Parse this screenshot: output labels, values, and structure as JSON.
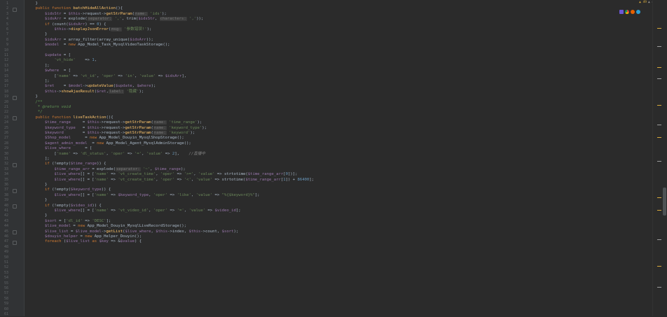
{
  "gutter": {
    "line_numbers": [
      "1",
      "2",
      "3",
      "4",
      "5",
      "6",
      "7",
      "8",
      "9",
      "10",
      "11",
      "12",
      "13",
      "14",
      "15",
      "16",
      "17",
      "18",
      "19",
      "20",
      "21",
      "22",
      "23",
      "24",
      "25",
      "26",
      "27",
      "28",
      "29",
      "30",
      "31",
      "32",
      "33",
      "34",
      "35",
      "36",
      "37",
      "38",
      "39",
      "40",
      "41",
      "42",
      "43",
      "44",
      "45",
      "46",
      "47",
      "48",
      "49",
      "50",
      "51",
      "52",
      "53",
      "54",
      "55",
      "56",
      "57",
      "58",
      "59",
      "60",
      "61"
    ]
  },
  "inspection": {
    "warnings": "▲ 49",
    "weak": "▲ 46",
    "ok": "✓ 1"
  },
  "browser_icons": [
    "phpstorm-icon",
    "chrome-icon",
    "firefox-icon",
    "edge-icon"
  ],
  "code_lines": [
    [
      [
        "    }",
        "d"
      ]
    ],
    [
      [
        "    ",
        "d"
      ],
      [
        "public function ",
        "kw"
      ],
      [
        "batchHideAllAction",
        "fn"
      ],
      [
        "(){",
        "d"
      ]
    ],
    [
      [
        "        ",
        "d"
      ],
      [
        "$idsStr",
        "var"
      ],
      [
        " = ",
        "d"
      ],
      [
        "$this",
        "var"
      ],
      [
        "->request->",
        "d"
      ],
      [
        "getStrParam",
        "fn"
      ],
      [
        "(",
        "d"
      ],
      [
        "name:",
        "hint"
      ],
      [
        " ",
        "d"
      ],
      [
        "'ids'",
        "str"
      ],
      [
        ");",
        "d"
      ]
    ],
    [
      [
        "        ",
        "d"
      ],
      [
        "$idsArr",
        "var"
      ],
      [
        " = explode(",
        "d"
      ],
      [
        "separator:",
        "hint"
      ],
      [
        " ",
        "d"
      ],
      [
        "','",
        "str"
      ],
      [
        ", trim(",
        "d"
      ],
      [
        "$idsStr",
        "var"
      ],
      [
        ", ",
        "d"
      ],
      [
        "characters:",
        "hint"
      ],
      [
        " ",
        "d"
      ],
      [
        "','",
        "str"
      ],
      [
        "));",
        "d"
      ]
    ],
    [
      [
        "        ",
        "d"
      ],
      [
        "if ",
        "kw"
      ],
      [
        "(count(",
        "d"
      ],
      [
        "$idsArr",
        "var"
      ],
      [
        ") == ",
        "d"
      ],
      [
        "0",
        "num"
      ],
      [
        ") {",
        "d"
      ]
    ],
    [
      [
        "            ",
        "d"
      ],
      [
        "$this",
        "var"
      ],
      [
        "->",
        "d"
      ],
      [
        "displayJsonError",
        "fn"
      ],
      [
        "(",
        "d"
      ],
      [
        "msg:",
        "hint"
      ],
      [
        " ",
        "d"
      ],
      [
        "'参数错误!'",
        "str"
      ],
      [
        ");",
        "d"
      ]
    ],
    [
      [
        "        }",
        "d"
      ]
    ],
    [
      [
        "        ",
        "d"
      ],
      [
        "$idsArr",
        "var"
      ],
      [
        " = array_filter(array_unique(",
        "d"
      ],
      [
        "$idsArr",
        "var"
      ],
      [
        "));",
        "d"
      ]
    ],
    [
      [
        "        ",
        "d"
      ],
      [
        "$model",
        "var"
      ],
      [
        "  = ",
        "d"
      ],
      [
        "new ",
        "kw"
      ],
      [
        "App_Model_Task_MysqlVideoTaskStorage",
        "cls"
      ],
      [
        "();",
        "d"
      ]
    ],
    [
      [
        "",
        "d"
      ]
    ],
    [
      [
        "        ",
        "d"
      ],
      [
        "$update",
        "var"
      ],
      [
        " = [",
        "d"
      ]
    ],
    [
      [
        "            ",
        "d"
      ],
      [
        "'vt_hide'",
        "str"
      ],
      [
        "    => ",
        "d"
      ],
      [
        "1",
        "num"
      ],
      [
        ",",
        "d"
      ]
    ],
    [
      [
        "        ];",
        "d"
      ]
    ],
    [
      [
        "        ",
        "d"
      ],
      [
        "$where",
        "var"
      ],
      [
        "  = [",
        "d"
      ]
    ],
    [
      [
        "            [",
        "d"
      ],
      [
        "'name'",
        "str"
      ],
      [
        " => ",
        "d"
      ],
      [
        "'vt_id'",
        "str"
      ],
      [
        ", ",
        "d"
      ],
      [
        "'oper'",
        "str"
      ],
      [
        " => ",
        "d"
      ],
      [
        "'in'",
        "str"
      ],
      [
        ", ",
        "d"
      ],
      [
        "'value'",
        "str"
      ],
      [
        " => ",
        "d"
      ],
      [
        "$idsArr",
        "var"
      ],
      [
        "],",
        "d"
      ]
    ],
    [
      [
        "        ];",
        "d"
      ]
    ],
    [
      [
        "        ",
        "d"
      ],
      [
        "$ret",
        "var"
      ],
      [
        "    = ",
        "d"
      ],
      [
        "$model",
        "var"
      ],
      [
        "->",
        "d"
      ],
      [
        "updateValue",
        "fn"
      ],
      [
        "(",
        "d"
      ],
      [
        "$update",
        "var"
      ],
      [
        ", ",
        "d"
      ],
      [
        "$where",
        "var"
      ],
      [
        ");",
        "d"
      ]
    ],
    [
      [
        "        ",
        "d"
      ],
      [
        "$this",
        "var"
      ],
      [
        "->",
        "d"
      ],
      [
        "showAjaxResult",
        "fn"
      ],
      [
        "(",
        "d"
      ],
      [
        "$ret",
        "var"
      ],
      [
        ",",
        "d"
      ],
      [
        "label:",
        "hint"
      ],
      [
        " ",
        "d"
      ],
      [
        "'隐藏'",
        "str"
      ],
      [
        ");",
        "d"
      ]
    ],
    [
      [
        "    }",
        "d"
      ]
    ],
    [
      [
        "    /**",
        "doc"
      ]
    ],
    [
      [
        "     * ",
        "doc"
      ],
      [
        "@return ",
        "doc"
      ],
      [
        "void",
        "doc"
      ]
    ],
    [
      [
        "     */",
        "doc"
      ]
    ],
    [
      [
        "    ",
        "d"
      ],
      [
        "public function ",
        "kw"
      ],
      [
        "liveTaskAction",
        "fn"
      ],
      [
        "(){",
        "d"
      ]
    ],
    [
      [
        "        ",
        "d"
      ],
      [
        "$time_range",
        "var"
      ],
      [
        "     = ",
        "d"
      ],
      [
        "$this",
        "var"
      ],
      [
        "->request->",
        "d"
      ],
      [
        "getStrParam",
        "fn"
      ],
      [
        "(",
        "d"
      ],
      [
        "name:",
        "hint"
      ],
      [
        " ",
        "d"
      ],
      [
        "'time_range'",
        "str"
      ],
      [
        ");",
        "d"
      ]
    ],
    [
      [
        "        ",
        "d"
      ],
      [
        "$keyword_type",
        "var"
      ],
      [
        "   = ",
        "d"
      ],
      [
        "$this",
        "var"
      ],
      [
        "->request->",
        "d"
      ],
      [
        "getStrParam",
        "fn"
      ],
      [
        "(",
        "d"
      ],
      [
        "name:",
        "hint"
      ],
      [
        " ",
        "d"
      ],
      [
        "'keyword_type'",
        "str"
      ],
      [
        ");",
        "d"
      ]
    ],
    [
      [
        "        ",
        "d"
      ],
      [
        "$keyword",
        "var"
      ],
      [
        "        = ",
        "d"
      ],
      [
        "$this",
        "var"
      ],
      [
        "->request->",
        "d"
      ],
      [
        "getStrParam",
        "fn"
      ],
      [
        "(",
        "d"
      ],
      [
        "name:",
        "hint"
      ],
      [
        " ",
        "d"
      ],
      [
        "'keyword'",
        "str"
      ],
      [
        ");",
        "d"
      ]
    ],
    [
      [
        "        ",
        "d"
      ],
      [
        "$Shop_model",
        "var"
      ],
      [
        "      = ",
        "d"
      ],
      [
        "new ",
        "kw"
      ],
      [
        "App_Model_Douyin_MysqlShopStorage",
        "cls"
      ],
      [
        "();",
        "d"
      ]
    ],
    [
      [
        "        ",
        "d"
      ],
      [
        "$agent_admin_model",
        "var"
      ],
      [
        "  = ",
        "d"
      ],
      [
        "new ",
        "kw"
      ],
      [
        "App_Model_Agent_MysqlAdminStorage",
        "cls"
      ],
      [
        "();",
        "d"
      ]
    ],
    [
      [
        "        ",
        "d"
      ],
      [
        "$live_where",
        "var"
      ],
      [
        "      = [",
        "d"
      ]
    ],
    [
      [
        "            [",
        "d"
      ],
      [
        "'name'",
        "str"
      ],
      [
        " => ",
        "d"
      ],
      [
        "'dl_status'",
        "str"
      ],
      [
        ", ",
        "d"
      ],
      [
        "'oper'",
        "str"
      ],
      [
        " => ",
        "d"
      ],
      [
        "'='",
        "str"
      ],
      [
        ", ",
        "d"
      ],
      [
        "'value'",
        "str"
      ],
      [
        " => ",
        "d"
      ],
      [
        "2",
        "num"
      ],
      [
        "],    ",
        "d"
      ],
      [
        "//直播中",
        "cmt"
      ]
    ],
    [
      [
        "        ];",
        "d"
      ]
    ],
    [
      [
        "        ",
        "d"
      ],
      [
        "if ",
        "kw"
      ],
      [
        "(!empty(",
        "d"
      ],
      [
        "$time_range",
        "var"
      ],
      [
        ")) {",
        "d"
      ]
    ],
    [
      [
        "            ",
        "d"
      ],
      [
        "$time_range_arr",
        "var"
      ],
      [
        " = explode(",
        "d"
      ],
      [
        "separator:",
        "hint"
      ],
      [
        " ",
        "d"
      ],
      [
        "'~'",
        "str"
      ],
      [
        ", ",
        "d"
      ],
      [
        "$time_range",
        "var"
      ],
      [
        ");",
        "d"
      ]
    ],
    [
      [
        "            ",
        "d"
      ],
      [
        "$live_where",
        "var"
      ],
      [
        "[] = [",
        "d"
      ],
      [
        "'name'",
        "str"
      ],
      [
        " => ",
        "d"
      ],
      [
        "'vt_create_time'",
        "str"
      ],
      [
        ", ",
        "d"
      ],
      [
        "'oper'",
        "str"
      ],
      [
        " => ",
        "d"
      ],
      [
        "'>='",
        "str"
      ],
      [
        ", ",
        "d"
      ],
      [
        "'value'",
        "str"
      ],
      [
        " => strtotime(",
        "d"
      ],
      [
        "$time_range_arr",
        "var"
      ],
      [
        "[",
        "d"
      ],
      [
        "0",
        "num"
      ],
      [
        "])];",
        "d"
      ]
    ],
    [
      [
        "            ",
        "d"
      ],
      [
        "$live_where",
        "var"
      ],
      [
        "[] = [",
        "d"
      ],
      [
        "'name'",
        "str"
      ],
      [
        " => ",
        "d"
      ],
      [
        "'vt_create_time'",
        "str"
      ],
      [
        ", ",
        "d"
      ],
      [
        "'oper'",
        "str"
      ],
      [
        " => ",
        "d"
      ],
      [
        "'<'",
        "str"
      ],
      [
        ", ",
        "d"
      ],
      [
        "'value'",
        "str"
      ],
      [
        " => strtotime(",
        "d"
      ],
      [
        "$time_range_arr",
        "var"
      ],
      [
        "[",
        "d"
      ],
      [
        "1",
        "num"
      ],
      [
        "]) + ",
        "d"
      ],
      [
        "86400",
        "num"
      ],
      [
        "];",
        "d"
      ]
    ],
    [
      [
        "        }",
        "d"
      ]
    ],
    [
      [
        "        ",
        "d"
      ],
      [
        "if ",
        "kw"
      ],
      [
        "(!empty(",
        "d"
      ],
      [
        "$keyword_type",
        "var"
      ],
      [
        ")) {",
        "d"
      ]
    ],
    [
      [
        "            ",
        "d"
      ],
      [
        "$live_where",
        "var"
      ],
      [
        "[] = [",
        "d"
      ],
      [
        "'name'",
        "str"
      ],
      [
        " => ",
        "d"
      ],
      [
        "$keyword_type",
        "var"
      ],
      [
        ", ",
        "d"
      ],
      [
        "'oper'",
        "str"
      ],
      [
        " => ",
        "d"
      ],
      [
        "'like'",
        "str"
      ],
      [
        ", ",
        "d"
      ],
      [
        "'value'",
        "str"
      ],
      [
        " => ",
        "d"
      ],
      [
        "\"%{$keyword}%\"",
        "str"
      ],
      [
        "];",
        "d"
      ]
    ],
    [
      [
        "        }",
        "d"
      ]
    ],
    [
      [
        "        ",
        "d"
      ],
      [
        "if ",
        "kw"
      ],
      [
        "(!empty(",
        "d"
      ],
      [
        "$video_id",
        "var"
      ],
      [
        ")) {",
        "d"
      ]
    ],
    [
      [
        "            ",
        "d"
      ],
      [
        "$live_where",
        "var"
      ],
      [
        "[] = [",
        "d"
      ],
      [
        "'name'",
        "str"
      ],
      [
        " => ",
        "d"
      ],
      [
        "'vt_video_id'",
        "str"
      ],
      [
        ", ",
        "d"
      ],
      [
        "'oper'",
        "str"
      ],
      [
        " => ",
        "d"
      ],
      [
        "'='",
        "str"
      ],
      [
        ", ",
        "d"
      ],
      [
        "'value'",
        "str"
      ],
      [
        " => ",
        "d"
      ],
      [
        "$video_id",
        "var"
      ],
      [
        "];",
        "d"
      ]
    ],
    [
      [
        "        }",
        "d"
      ]
    ],
    [
      [
        "        ",
        "d"
      ],
      [
        "$sort",
        "var"
      ],
      [
        " = [",
        "d"
      ],
      [
        "'dl_id'",
        "str"
      ],
      [
        " => ",
        "d"
      ],
      [
        "'DESC'",
        "str"
      ],
      [
        "];",
        "d"
      ]
    ],
    [
      [
        "        ",
        "d"
      ],
      [
        "$live_model",
        "var"
      ],
      [
        " = ",
        "d"
      ],
      [
        "new ",
        "kw"
      ],
      [
        "App_Model_Douyin_MysqlLiveRecordStorage",
        "cls"
      ],
      [
        "();",
        "d"
      ]
    ],
    [
      [
        "        ",
        "d"
      ],
      [
        "$live_list",
        "var"
      ],
      [
        " = ",
        "d"
      ],
      [
        "$live_model",
        "var"
      ],
      [
        "->",
        "d"
      ],
      [
        "getList",
        "fn"
      ],
      [
        "(",
        "d"
      ],
      [
        "$live_where",
        "var"
      ],
      [
        ", ",
        "d"
      ],
      [
        "$this",
        "var"
      ],
      [
        "->index, ",
        "d"
      ],
      [
        "$this",
        "var"
      ],
      [
        "->count, ",
        "d"
      ],
      [
        "$sort",
        "var"
      ],
      [
        ");",
        "d"
      ]
    ],
    [
      [
        "        ",
        "d"
      ],
      [
        "$douyin_helper",
        "var"
      ],
      [
        " = ",
        "d"
      ],
      [
        "new ",
        "kw"
      ],
      [
        "App_Helper_Douyin",
        "cls"
      ],
      [
        "();",
        "d"
      ]
    ],
    [
      [
        "        ",
        "d"
      ],
      [
        "foreach ",
        "kw"
      ],
      [
        "(",
        "d"
      ],
      [
        "$live_list",
        "var"
      ],
      [
        " as ",
        "kw"
      ],
      [
        "$key",
        "var"
      ],
      [
        " => &",
        "d"
      ],
      [
        "$value",
        "var"
      ],
      [
        ") {",
        "d"
      ]
    ]
  ]
}
